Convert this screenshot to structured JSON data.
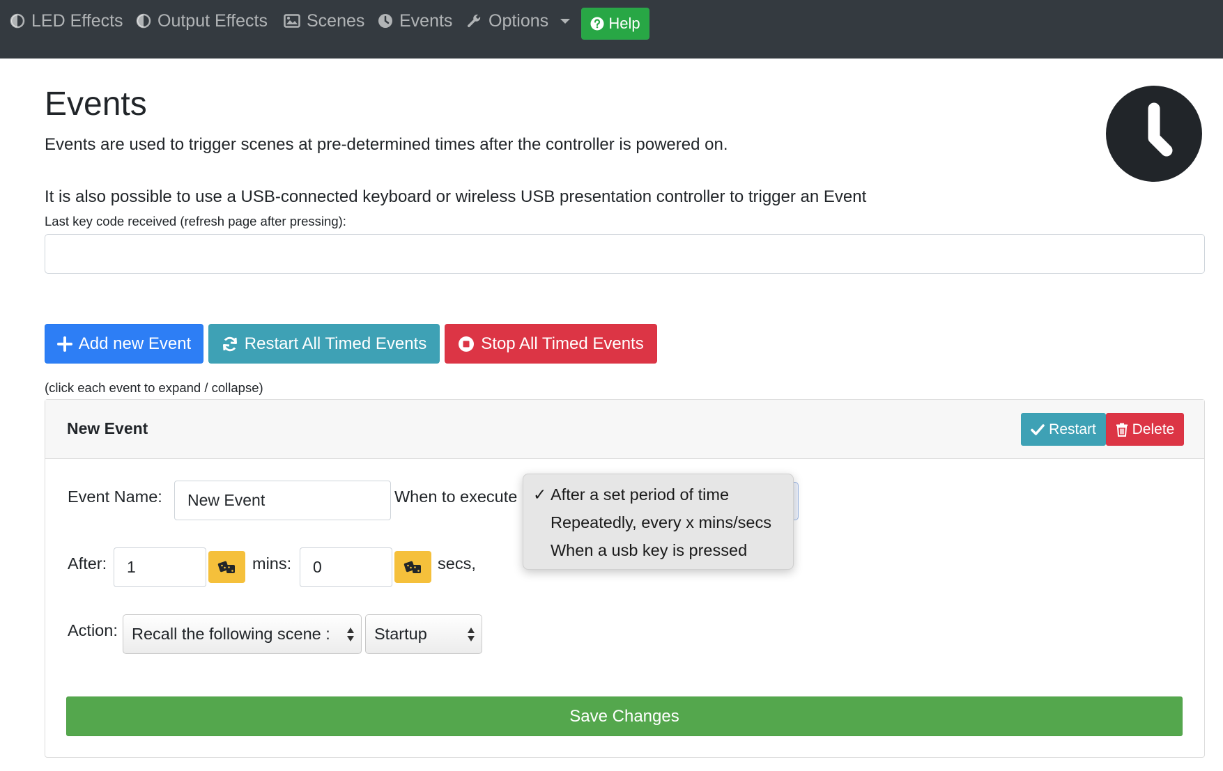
{
  "nav": {
    "items": [
      {
        "label": "LED Effects",
        "icon": "half-circle-icon"
      },
      {
        "label": "Output Effects",
        "icon": "half-circle-icon"
      },
      {
        "label": "Scenes",
        "icon": "image-icon"
      },
      {
        "label": "Events",
        "icon": "clock-icon"
      },
      {
        "label": "Options",
        "icon": "wrench-icon"
      }
    ],
    "help_label": "Help"
  },
  "header": {
    "title": "Events",
    "description": "Events are used to trigger scenes at pre-determined times after the controller is powered on.",
    "usb_note": "It is also possible to use a USB-connected keyboard or wireless USB presentation controller to trigger an Event",
    "last_key_label": "Last key code received (refresh page after pressing):",
    "last_key_value": ""
  },
  "actions": {
    "add_label": "Add new Event",
    "restart_all_label": "Restart All Timed Events",
    "stop_all_label": "Stop All Timed Events",
    "hint": "(click each event to expand / collapse)"
  },
  "event": {
    "title": "New Event",
    "restart_label": "Restart",
    "delete_label": "Delete",
    "name_label": "Event Name:",
    "name_value": "New Event",
    "when_label": "When to execute",
    "when_options": [
      {
        "label": "After a set period of time",
        "selected": true
      },
      {
        "label": "Repeatedly, every x mins/secs",
        "selected": false
      },
      {
        "label": "When a usb key is pressed",
        "selected": false
      }
    ],
    "check_mark": "✓",
    "after_label": "After:",
    "mins_value": "1",
    "mins_label": "mins:",
    "secs_value": "0",
    "secs_label": "secs,",
    "action_label": "Action:",
    "action_value": "Recall the following scene :",
    "scene_value": "Startup",
    "save_label": "Save Changes"
  },
  "colors": {
    "navbar": "#343a40",
    "primary": "#2d7ef5",
    "info": "#3ea1b5",
    "danger": "#dc3545",
    "success": "#54a74d",
    "warning": "#f5c03b"
  }
}
